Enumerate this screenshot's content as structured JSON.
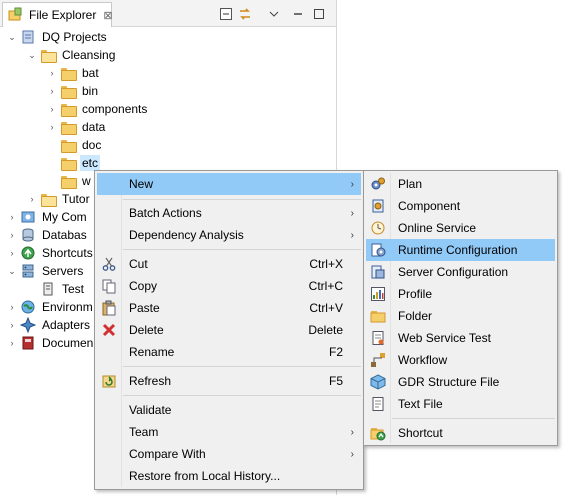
{
  "view": {
    "tab_label": "File Explorer",
    "close_glyph": "⊠"
  },
  "tree": {
    "dq_projects": "DQ Projects",
    "cleansing": "Cleansing",
    "bat": "bat",
    "bin": "bin",
    "components": "components",
    "data": "data",
    "doc": "doc",
    "etc": "etc",
    "w_partial": "w",
    "tutor_partial": "Tutor",
    "mycom_partial": "My Com",
    "database_partial": "Databas",
    "shortcuts_partial": "Shortcuts",
    "servers": "Servers",
    "test": "Test",
    "environ_partial": "Environm",
    "adapters": "Adapters",
    "documen_partial": "Documen"
  },
  "context_menu": {
    "new": "New",
    "batch_actions": "Batch Actions",
    "dependency_analysis": "Dependency Analysis",
    "cut": "Cut",
    "cut_key": "Ctrl+X",
    "copy": "Copy",
    "copy_key": "Ctrl+C",
    "paste": "Paste",
    "paste_key": "Ctrl+V",
    "delete": "Delete",
    "delete_key": "Delete",
    "rename": "Rename",
    "rename_key": "F2",
    "refresh": "Refresh",
    "refresh_key": "F5",
    "validate": "Validate",
    "team": "Team",
    "compare_with": "Compare With",
    "restore": "Restore from Local History..."
  },
  "new_submenu": {
    "plan": "Plan",
    "component": "Component",
    "online_service": "Online Service",
    "runtime_configuration": "Runtime Configuration",
    "server_configuration": "Server Configuration",
    "profile": "Profile",
    "folder": "Folder",
    "web_service_test": "Web Service Test",
    "workflow": "Workflow",
    "gdr_structure_file": "GDR Structure File",
    "text_file": "Text File",
    "shortcut": "Shortcut"
  },
  "glyphs": {
    "submenu_arrow": "›",
    "expanded": "⌄",
    "collapsed": "›"
  },
  "colors": {
    "menu_highlight": "#91c9f7",
    "selection": "#cce8ff",
    "menu_bg": "#f0f0f0"
  }
}
